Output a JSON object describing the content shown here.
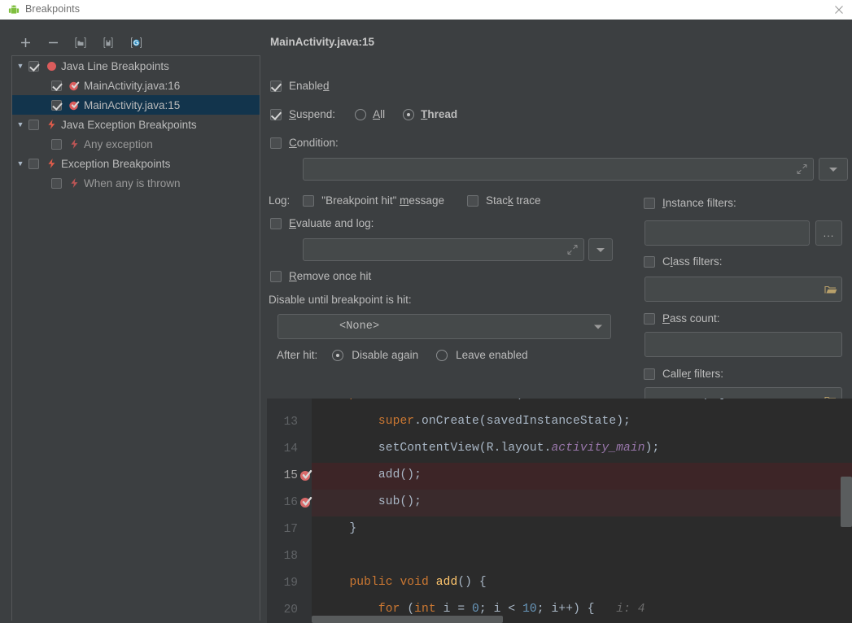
{
  "window": {
    "title": "Breakpoints",
    "app_icon": "android-robot-icon",
    "close_icon": "close-icon"
  },
  "toolbar": {
    "buttons": [
      {
        "name": "add-breakpoint-button",
        "icon": "plus-icon"
      },
      {
        "name": "remove-breakpoint-button",
        "icon": "minus-icon"
      },
      {
        "name": "export-breakpoints-button",
        "icon": "folder-out-icon"
      },
      {
        "name": "import-breakpoints-button",
        "icon": "folder-in-icon"
      },
      {
        "name": "mute-breakpoints-button",
        "icon": "mute-breakpoints-icon"
      }
    ]
  },
  "tree": {
    "items": [
      {
        "label": "Java Line Breakpoints",
        "level": 0,
        "expander": "▼",
        "checked": true,
        "icon": "red-dot-icon",
        "selected": false,
        "dim": false
      },
      {
        "label": "MainActivity.java:16",
        "level": 1,
        "expander": "",
        "checked": true,
        "icon": "breakpoint-checked-icon",
        "selected": false,
        "dim": false
      },
      {
        "label": "MainActivity.java:15",
        "level": 1,
        "expander": "",
        "checked": true,
        "icon": "breakpoint-checked-icon",
        "selected": true,
        "dim": false
      },
      {
        "label": "Java Exception Breakpoints",
        "level": 0,
        "expander": "▼",
        "checked": false,
        "icon": "exception-bolt-icon",
        "selected": false,
        "dim": false
      },
      {
        "label": "Any exception",
        "level": 1,
        "expander": "",
        "checked": false,
        "icon": "exception-bolt-dim-icon",
        "selected": false,
        "dim": true
      },
      {
        "label": "Exception Breakpoints",
        "level": 0,
        "expander": "▼",
        "checked": false,
        "icon": "exception-bolt-icon",
        "selected": false,
        "dim": false
      },
      {
        "label": "When any is thrown",
        "level": 1,
        "expander": "",
        "checked": false,
        "icon": "exception-bolt-dim-icon",
        "selected": false,
        "dim": true
      }
    ]
  },
  "detail": {
    "title": "MainActivity.java:15",
    "enabled": {
      "label": "Enabled",
      "checked": true
    },
    "suspend": {
      "label": "Suspend:",
      "checked": true,
      "options": [
        {
          "label": "All",
          "selected": false
        },
        {
          "label": "Thread",
          "selected": true
        }
      ]
    },
    "condition": {
      "label": "Condition:",
      "checked": false,
      "value": "",
      "expand_icon": "expand-editor-icon",
      "dropdown_icon": "history-dropdown-icon"
    },
    "log": {
      "label": "Log:",
      "breakpoint_hit_message": {
        "label": "\"Breakpoint hit\" message",
        "checked": false
      },
      "stack_trace": {
        "label": "Stack trace",
        "checked": false
      }
    },
    "evaluate_and_log": {
      "label": "Evaluate and log:",
      "checked": false,
      "value": "",
      "expand_icon": "expand-editor-icon",
      "dropdown_icon": "history-dropdown-icon"
    },
    "remove_once_hit": {
      "label": "Remove once hit",
      "checked": false
    },
    "disable_until": {
      "label": "Disable until breakpoint is hit:",
      "value": "<None>",
      "dropdown_icon": "chevron-down-icon"
    },
    "after_hit": {
      "label": "After hit:",
      "options": [
        {
          "label": "Disable again",
          "selected": true
        },
        {
          "label": "Leave enabled",
          "selected": false
        }
      ]
    },
    "instance_filters": {
      "label": "Instance filters:",
      "checked": false,
      "value": "",
      "button_label": "...",
      "button_icon": "ellipsis-icon"
    },
    "class_filters": {
      "label": "Class filters:",
      "checked": false,
      "value": "",
      "icon": "folder-icon"
    },
    "pass_count": {
      "label": "Pass count:",
      "checked": false,
      "value": ""
    },
    "caller_filters": {
      "label": "Caller filters:",
      "checked": false,
      "value": "",
      "icon": "folder-icon"
    }
  },
  "editor": {
    "lines": [
      {
        "number": "13",
        "breakpoint": false,
        "highlight": "none",
        "tokens": [
          {
            "t": "        ",
            "c": "pl"
          },
          {
            "t": "super",
            "c": "kw"
          },
          {
            "t": ".",
            "c": "pl"
          },
          {
            "t": "onCreate(savedInstanceState);",
            "c": "pl"
          }
        ]
      },
      {
        "number": "14",
        "breakpoint": false,
        "highlight": "none",
        "tokens": [
          {
            "t": "        setContentView(R.layout.",
            "c": "pl"
          },
          {
            "t": "activity_main",
            "c": "fld2"
          },
          {
            "t": ");",
            "c": "pl"
          }
        ]
      },
      {
        "number": "15",
        "breakpoint": true,
        "highlight": "current",
        "tokens": [
          {
            "t": "        add();",
            "c": "pl"
          }
        ]
      },
      {
        "number": "16",
        "breakpoint": true,
        "highlight": "breakpoint",
        "tokens": [
          {
            "t": "        sub();",
            "c": "pl"
          }
        ]
      },
      {
        "number": "17",
        "breakpoint": false,
        "highlight": "none",
        "tokens": [
          {
            "t": "    }",
            "c": "pl"
          }
        ]
      },
      {
        "number": "18",
        "breakpoint": false,
        "highlight": "none",
        "tokens": []
      },
      {
        "number": "19",
        "breakpoint": false,
        "highlight": "none",
        "tokens": [
          {
            "t": "    ",
            "c": "pl"
          },
          {
            "t": "public void ",
            "c": "kw"
          },
          {
            "t": "add",
            "c": "fn"
          },
          {
            "t": "() {",
            "c": "pl"
          }
        ]
      },
      {
        "number": "20",
        "breakpoint": false,
        "highlight": "none",
        "tokens": [
          {
            "t": "        ",
            "c": "pl"
          },
          {
            "t": "for ",
            "c": "kw"
          },
          {
            "t": "(",
            "c": "pl"
          },
          {
            "t": "int ",
            "c": "kw"
          },
          {
            "t": "i = ",
            "c": "pl"
          },
          {
            "t": "0",
            "c": "num"
          },
          {
            "t": "; i < ",
            "c": "pl"
          },
          {
            "t": "10",
            "c": "num"
          },
          {
            "t": "; i++) {",
            "c": "pl"
          },
          {
            "t": "   i: 4",
            "c": "hint"
          }
        ]
      }
    ]
  },
  "colors": {
    "window_bg": "#3c3f41",
    "title_bg": "#ffffff",
    "editor_bg": "#2b2b2b",
    "gutter_bg": "#313335",
    "selection_blue": "#12344c",
    "breakpoint_red": "#db5c5c",
    "keyword_orange": "#cc7832",
    "number_blue": "#6897bb",
    "method_yellow": "#ffc66d",
    "field_purple": "#9876aa",
    "exec_line_red": "#3d2527",
    "bp_line_red": "#3a2a2c",
    "accent_cyan": "#3592c4"
  }
}
